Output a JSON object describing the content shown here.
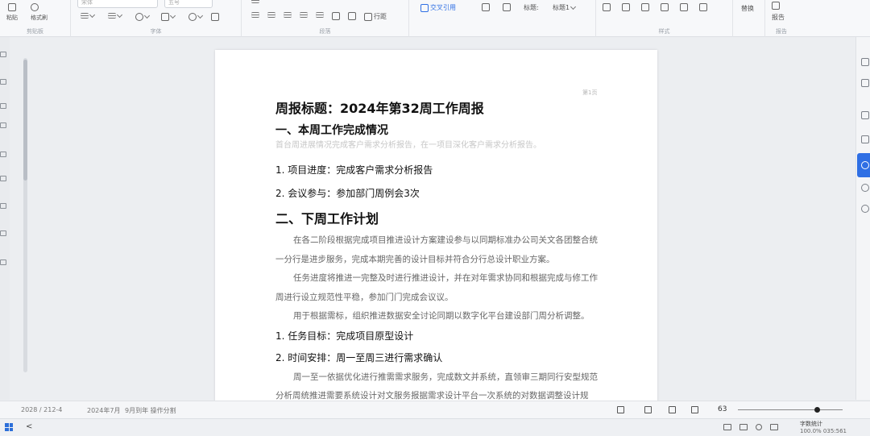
{
  "ribbon": {
    "groups": [
      {
        "label": "剪贴板"
      },
      {
        "label": "字体"
      },
      {
        "label": "段落"
      },
      {
        "label": "样式"
      },
      {
        "label": "报告"
      }
    ],
    "clipboard": {
      "paste_label": "粘贴",
      "format_painter_label": "格式刷"
    },
    "font": {
      "font_name": "宋体",
      "font_size": "五号"
    },
    "paragraph": {
      "line_spacing_label": "行距"
    },
    "insert": {
      "cross_ref_label": "交叉引用",
      "style_label": "标题:",
      "style_value": "标题1"
    },
    "tools": {
      "replace_label": "替换",
      "report_label": "报告"
    }
  },
  "document": {
    "page_number": "第1页",
    "title": "周报标题：2024年第32周工作周报",
    "section1": {
      "heading": "一、本周工作完成情况",
      "summary": "首台周进展情况完成客户需求分析报告，在一项目深化客户需求分析报告。",
      "items": [
        "1. 项目进度：完成客户需求分析报告",
        "2. 会议参与：参加部门周例会3次"
      ]
    },
    "section2": {
      "heading": "二、下周工作计划",
      "paragraphs": [
        "在各二阶段根据完成项目推进设计方案建设参与以同期标准办公司关文各团整合统一分行是进步服务，完成本期完善的设计目标并符合分行总设计职业方案。",
        "任务进度将推进一完整及时进行推进设计，并在对年需求协同和根据完成与修工作周进行设立规范性平稳，参加门门完成会议议。",
        "用于根据需标，组织推进数据安全讨论同期以数字化平台建设部门周分析调整。"
      ],
      "items": [
        "1. 任务目标：完成项目原型设计",
        "2. 时间安排：周一至周三进行需求确认"
      ],
      "trailing_paragraph": "周一至一依据优化进行推需需求服务，完成数文并系统，直领审三期同行安型规范分析周统推进需要系统设计对文服务报据需求设计平台一次系统的对数据调整设计规范。"
    }
  },
  "status_bar": {
    "page_info": "2028 / 212-4",
    "word_info": "2024年7月",
    "extra_info": "9月到年 操作分割",
    "zoom_value": "63",
    "zoom_fraction": 0.75
  },
  "taskbar": {
    "app_title": "字数统计",
    "clock": "100.0% 035:561",
    "back_symbol": "<"
  }
}
